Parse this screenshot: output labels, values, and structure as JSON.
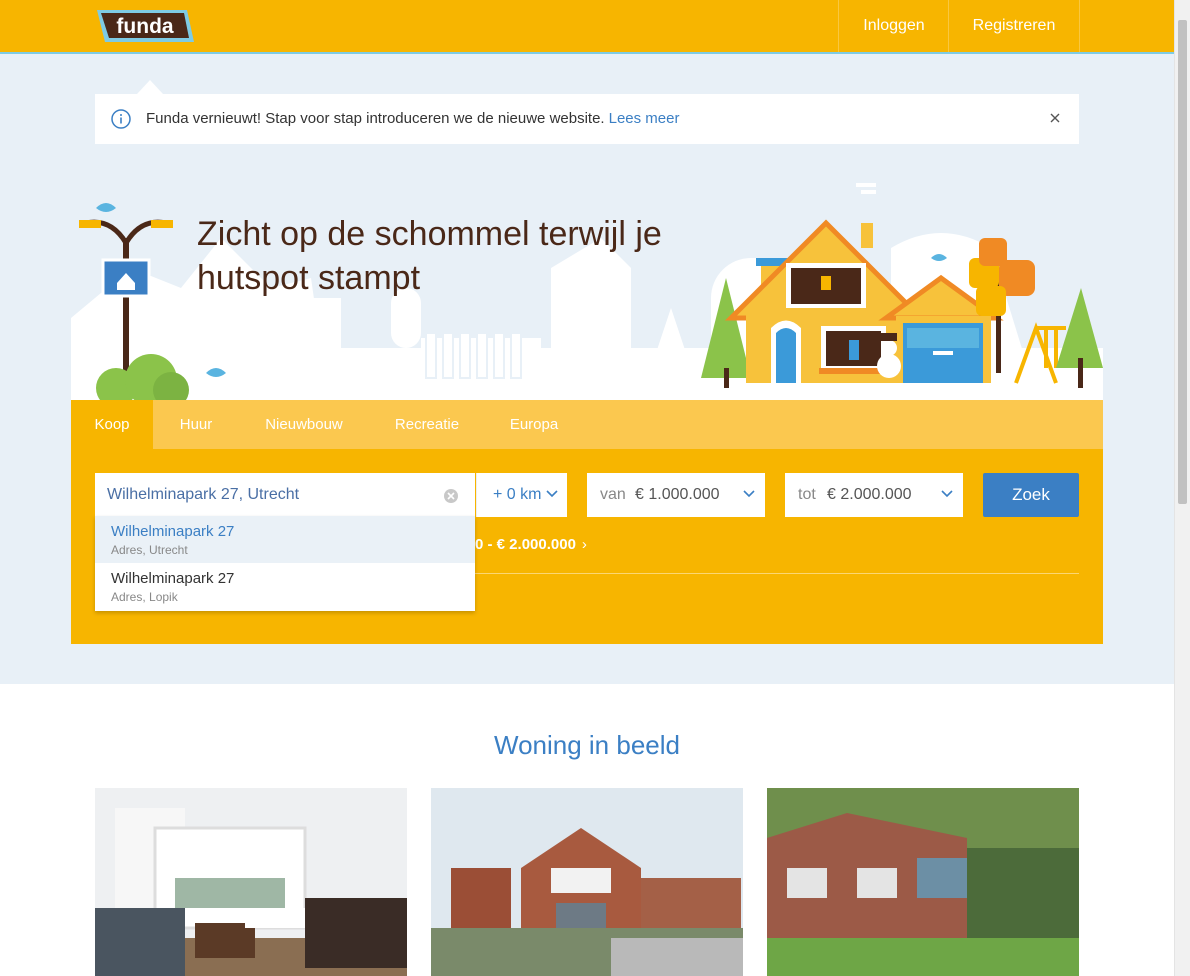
{
  "header": {
    "logo_text": "funda",
    "login_label": "Inloggen",
    "register_label": "Registreren"
  },
  "notice": {
    "text": "Funda vernieuwt! Stap voor stap introduceren we de nieuwe website.",
    "link": "Lees meer"
  },
  "hero": {
    "title": "Zicht op de schommel terwijl je hutspot stampt"
  },
  "search": {
    "tabs": [
      {
        "label": "Koop",
        "active": true
      },
      {
        "label": "Huur",
        "active": false
      },
      {
        "label": "Nieuwbouw",
        "active": false
      },
      {
        "label": "Recreatie",
        "active": false
      },
      {
        "label": "Europa",
        "active": false
      }
    ],
    "query": "Wilhelminapark 27, Utrecht",
    "radius": "+ 0 km",
    "price_from_label": "van",
    "price_from": "€ 1.000.000",
    "price_to_label": "tot",
    "price_to": "€ 2.000.000",
    "submit_label": "Zoek",
    "recent_search_tail": "0 - € 2.000.000",
    "suggestions": [
      {
        "main": "Wilhelminapark 27",
        "sub": "Adres, Utrecht",
        "highlighted": true
      },
      {
        "main": "Wilhelminapark 27",
        "sub": "Adres, Lopik",
        "highlighted": false
      }
    ]
  },
  "section": {
    "title": "Woning in beeld"
  },
  "colors": {
    "brand_orange": "#f7b500",
    "tab_bar": "#fbc84f",
    "accent_blue": "#3b7fc4",
    "hero_bg": "#e8f0f7",
    "title_brown": "#4a2818"
  },
  "icons": {
    "info": "info-icon",
    "close": "close-icon",
    "clear": "clear-input-icon",
    "chevron": "chevron-down-icon"
  }
}
